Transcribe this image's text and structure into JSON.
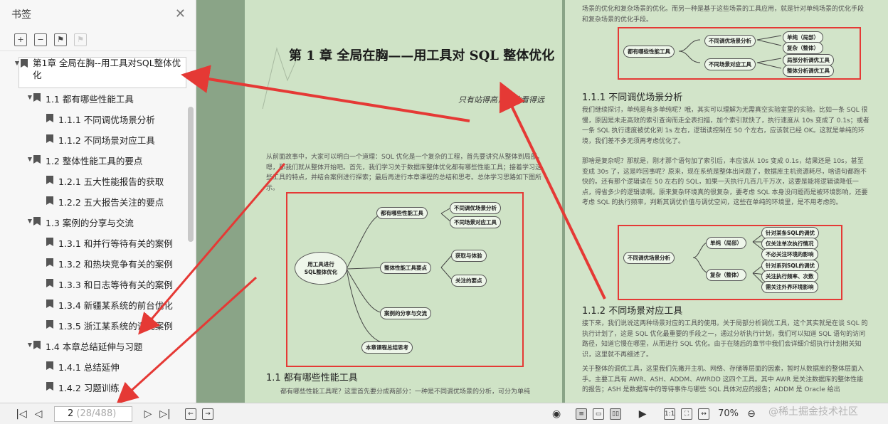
{
  "sidebar": {
    "title": "书签",
    "tree": [
      {
        "level": 0,
        "label": "第1章   全局在胸--用工具对SQL整体优化",
        "selected": true
      },
      {
        "level": 1,
        "label": "1.1 都有哪些性能工具"
      },
      {
        "level": 2,
        "label": "1.1.1 不同调优场景分析"
      },
      {
        "level": 2,
        "label": "1.1.2 不同场景对应工具"
      },
      {
        "level": 1,
        "label": "1.2 整体性能工具的要点"
      },
      {
        "level": 2,
        "label": "1.2.1 五大性能报告的获取"
      },
      {
        "level": 2,
        "label": "1.2.2 五大报告关注的要点"
      },
      {
        "level": 1,
        "label": "1.3 案例的分享与交流"
      },
      {
        "level": 2,
        "label": "1.3.1 和并行等待有关的案例"
      },
      {
        "level": 2,
        "label": "1.3.2 和热块竞争有关的案例"
      },
      {
        "level": 2,
        "label": "1.3.3 和日志等待有关的案例"
      },
      {
        "level": 2,
        "label": "1.3.4 新疆某系统的前台优化"
      },
      {
        "level": 2,
        "label": "1.3.5 浙江某系统的调优案例"
      },
      {
        "level": 1,
        "label": "1.4 本章总结延伸与习题"
      },
      {
        "level": 2,
        "label": "1.4.1 总结延伸"
      },
      {
        "level": 2,
        "label": "1.4.2 习题训练"
      }
    ]
  },
  "bottombar": {
    "page_current": "2",
    "page_total": " (28/488)",
    "zoom": "70%",
    "watermark": "@稀土掘金技术社区"
  },
  "doc": {
    "top_text": "场景的优化和复杂场景的优化。而另一种是基于这些场景的工具应用，就是针对单纯场景的优化手段和复杂场景的优化手段。",
    "chapter_title": "第 1 章    全局在胸——用工具对 SQL 整体优化",
    "epigraph": "只有站得高，你才看得远",
    "intro": "从前面故事中，大家可以明白一个道理：SQL 优化是一个复杂的工程，首先要讲究从整体到局部。嗯，那我们就从整体开始吧。首先，我们学习关于数据库整体优化都有哪些性能工具；接着学习这些工具的特点，并结合案例进行探索；最后再进行本章课程的总结和思考。总体学习思路如下图所示。",
    "sec11": "1.1   都有哪些性能工具",
    "sec11_text": "都有哪些性能工具呢？这里首先要分成两部分：一种是不同调优场景的分析，可分为单纯",
    "sec111": "1.1.1   不同调优场景分析",
    "sec111_text1": "我们继续探讨，单纯是有多单纯呢？哦，其实可以理解为无需真空实验室里的实验。比如一条 SQL 很慢，原因是未走高效的索引查询而走全表扫描，加个索引就快了，执行速度从 10s 变成了 0.1s；或者一条 SQL 执行速度被优化到 1s 左右，逻辑读控制在 50 个左右，应该就已经 OK。这就是单纯的环境，我们差不多无须再考虑优化了。",
    "sec111_text2": "那啥是复杂呢？那就是，刚才那个语句加了索引后，本应该从 10s 变成 0.1s，结果还是 10s，甚至变成 30s 了，这是咋回事呢？原来，现在系统是整体出问题了，数据库主机资源耗尽，啥语句都跑不快的。还有那个逻辑读在 50 左右的 SQL，如果一天执行几百几千万次，这要是能将逻辑读降低一点，得省多少的逻辑读啊。原来复杂环境真的很复杂，要考虑 SQL 本身没问题而是被环境影响，还要考虑 SQL 的执行频率，判断其调优价值与调优空间，这些在单纯的环境里，是不用考虑的。",
    "sec112": "1.1.2   不同场景对应工具",
    "sec112_text1": "接下来，我们说说这两种场景对应的工具的使用。关于局部分析调优工具，这个其实就是在谈 SQL 的执行计划了，这是 SQL 优化最重要的手段之一，通过分析执行计划，我们可以知道 SQL 语句的访问路径，知道它慢在哪里，从而进行 SQL 优化。由于在随后的章节中我们会详细介绍执行计划相关知识，这里就不再细述了。",
    "sec112_text2": "关于整体的调优工具，这里我们先撇开主机、网络、存储等层面的因素，暂时从数据库的整体层面入手。主要工具有 AWR、ASH、ADDM、AWRDD 这四个工具。其中 AWR 是关注数据库的整体性能的报告；ASH 是数据库中的等待事件与哪些 SQL 具体对应的报告；ADDM 是 Oracle 给出",
    "mm_main": {
      "root": "用工具进行\nSQL整体优化",
      "n1": "都有哪些性能工具",
      "n1a": "不同调优场景分析",
      "n1b": "不同场景对应工具",
      "n2": "整体性能工具要点",
      "n2a": "获取与体验",
      "n2b": "关注的要点",
      "n3": "案例的分享与交流",
      "n4": "本章课程总结思考"
    },
    "mm_top": {
      "root": "都有哪些性能工具",
      "a": "不同调优场景分析",
      "a1": "单纯（局部）",
      "a2": "复杂（整体）",
      "b": "不同场景对应工具",
      "b1": "局部分析调优工具",
      "b2": "整体分析调优工具"
    },
    "mm_mid": {
      "root": "不同调优场景分析",
      "a": "单纯（局部）",
      "a1": "针对某条SQL的调优",
      "a2": "仅关注单次执行情况",
      "a3": "不必关注环境的影响",
      "b": "复杂（整体）",
      "b1": "针对系列SQL的调优",
      "b2": "关注执行频率、次数",
      "b3": "需关注外界环境影响"
    }
  }
}
